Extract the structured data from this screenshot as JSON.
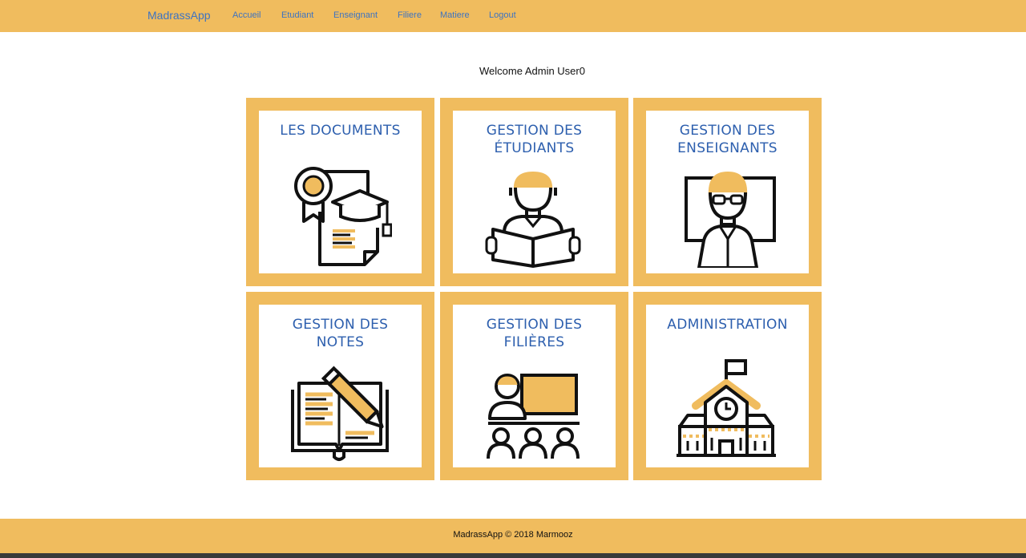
{
  "navbar": {
    "brand": "MadrassApp",
    "links": [
      "Accueil",
      "Etudiant",
      "Enseignant",
      "Filiere",
      "Matiere",
      "Logout"
    ]
  },
  "welcome": "Welcome Admin User0",
  "tiles": [
    {
      "title_line1": "LES DOCUMENTS",
      "title_line2": "",
      "icon": "diploma-graduation-icon"
    },
    {
      "title_line1": "GESTION DES",
      "title_line2": "ÉTUDIANTS",
      "icon": "student-reading-icon"
    },
    {
      "title_line1": "GESTION DES",
      "title_line2": "ENSEIGNANTS",
      "icon": "teacher-board-icon"
    },
    {
      "title_line1": "GESTION DES",
      "title_line2": "NOTES",
      "icon": "notebook-pencil-icon"
    },
    {
      "title_line1": "GESTION DES",
      "title_line2": "FILIÈRES",
      "icon": "classroom-icon"
    },
    {
      "title_line1": "ADMINISTRATION",
      "title_line2": "",
      "icon": "school-building-icon"
    }
  ],
  "footer": "MadrassApp © 2018 Marmooz",
  "colors": {
    "accent": "#f0bc5e",
    "link": "#3d73c2",
    "title": "#2d5fae"
  }
}
